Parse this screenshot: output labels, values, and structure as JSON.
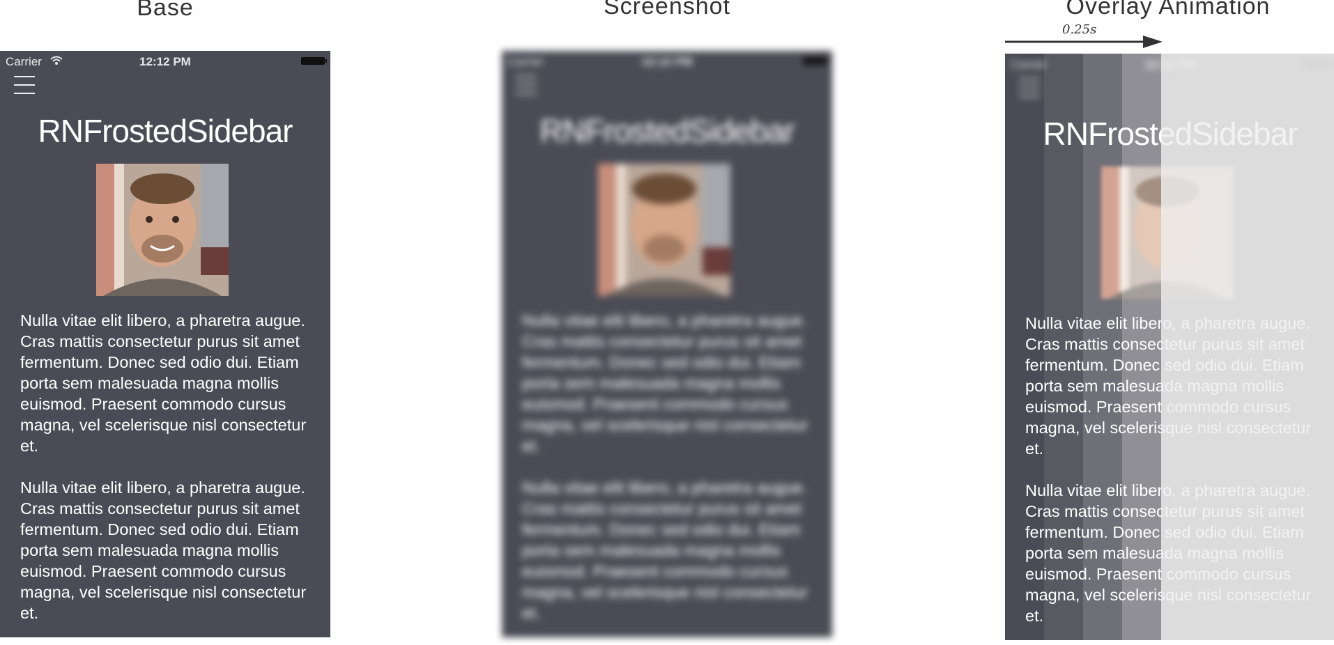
{
  "columns": {
    "base_title": "Base",
    "screenshot_title": "Screenshot",
    "overlay_title": "Overlay Animation"
  },
  "animation": {
    "duration_label": "0.25s"
  },
  "phone": {
    "status_bar": {
      "carrier": "Carrier",
      "time": "12:12 PM"
    },
    "app_title": "RNFrostedSidebar",
    "paragraphs": [
      "Nulla vitae elit libero, a pharetra augue. Cras mattis consectetur purus sit amet fermentum. Donec sed odio dui. Etiam porta sem malesuada magna mollis euismod. Praesent commodo cursus magna, vel scelerisque nisl consectetur et.",
      "Nulla vitae elit libero, a pharetra augue. Cras mattis consectetur purus sit amet fermentum. Donec sed odio dui. Etiam porta sem malesuada magna mollis euismod. Praesent commodo cursus magna, vel scelerisque nisl consectetur et."
    ]
  },
  "colors": {
    "phone_background": "#4b4b55",
    "overlay_tint": "#ffffff"
  },
  "icons": {
    "menu": "hamburger-menu-icon",
    "wifi": "wifi-icon",
    "battery": "battery-icon",
    "arrow": "right-arrow-icon"
  }
}
